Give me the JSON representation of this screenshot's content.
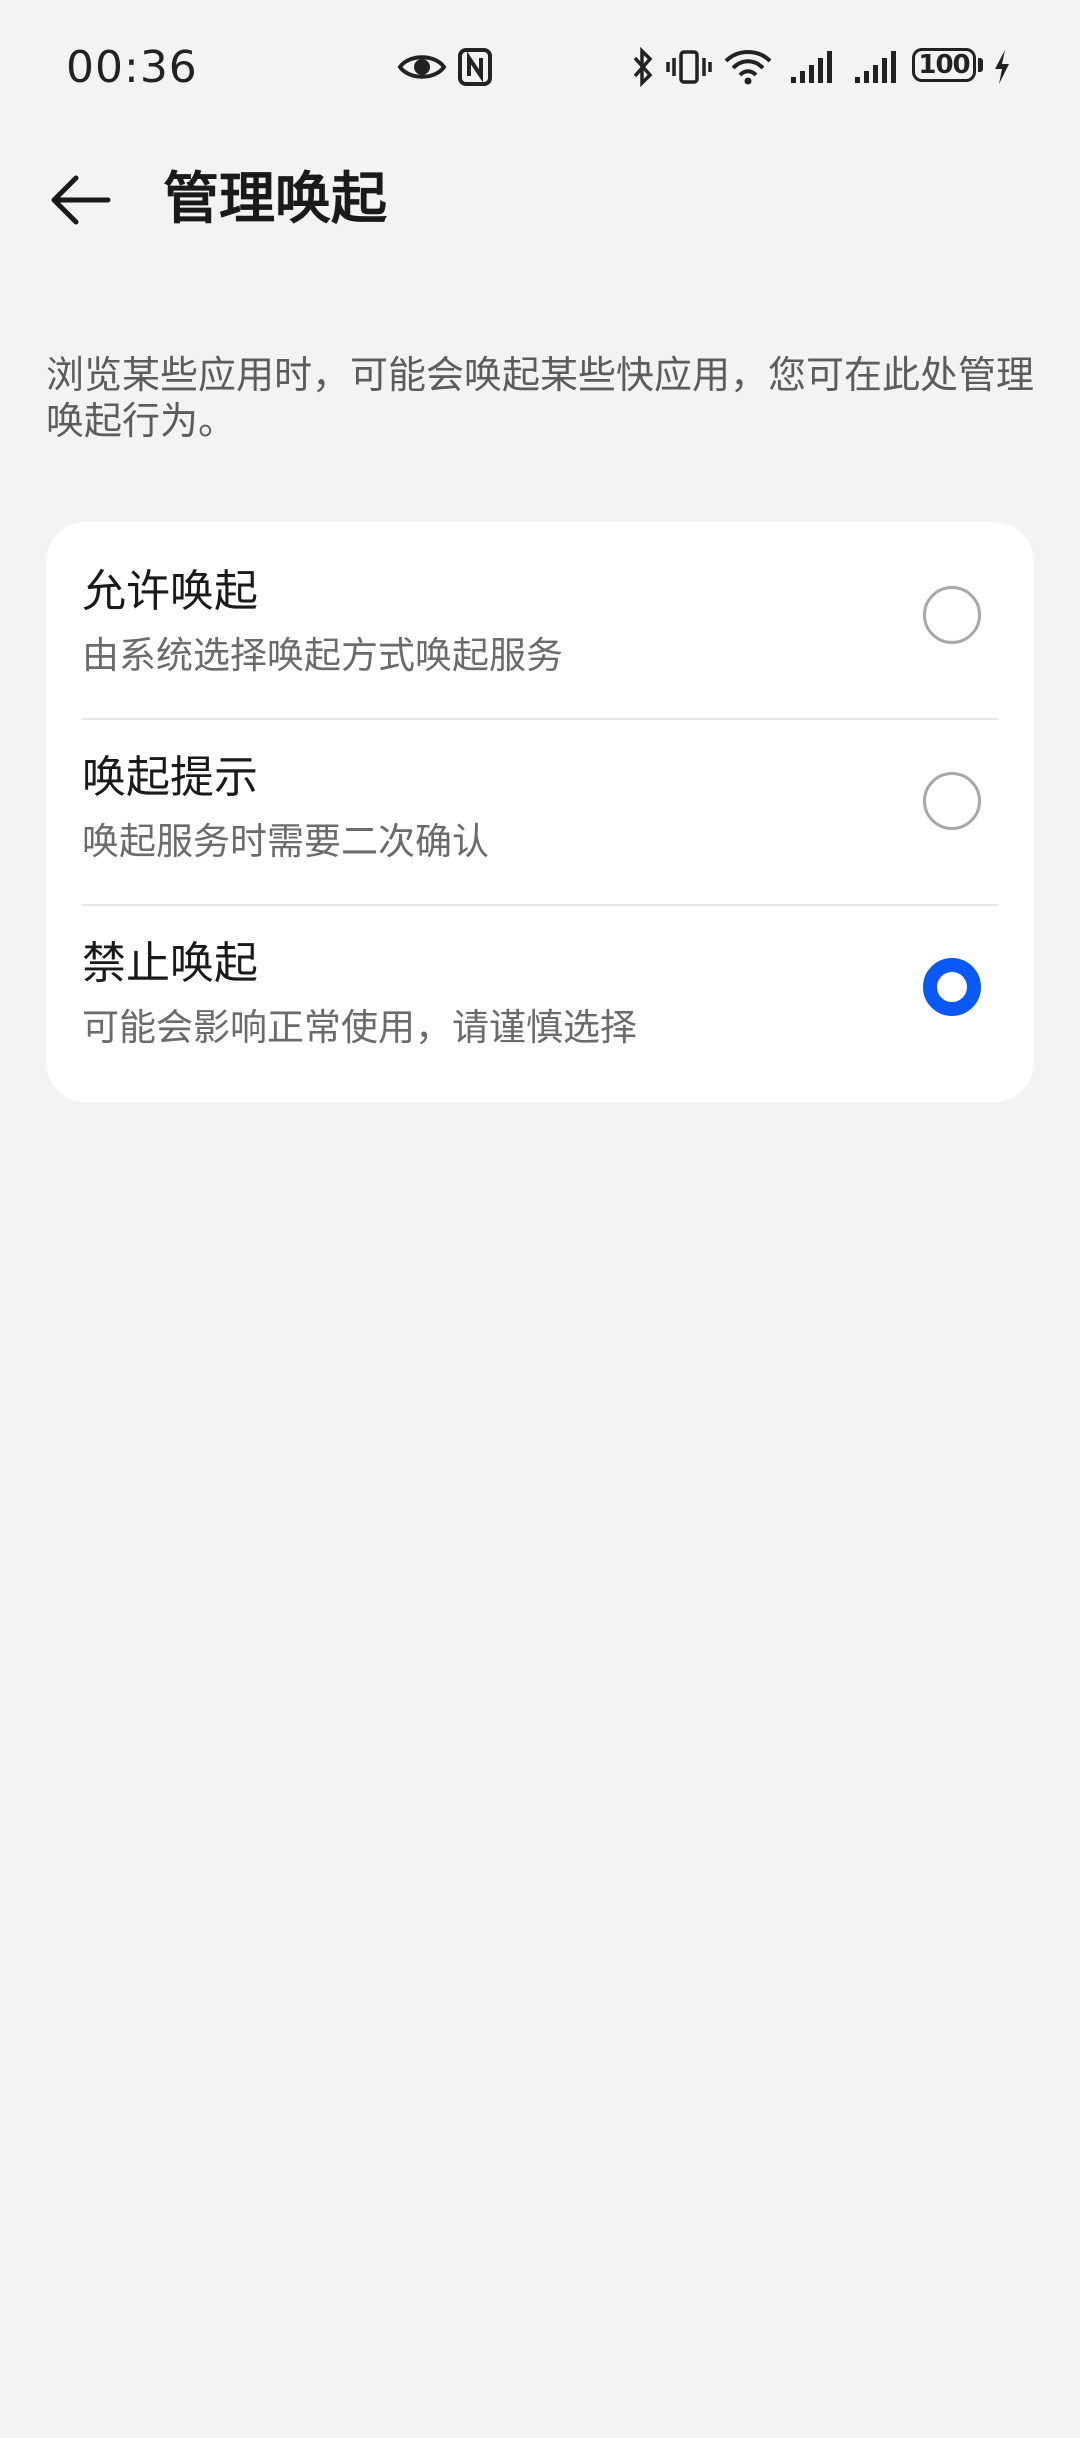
{
  "status_bar": {
    "time": "00:36",
    "battery_level": "100",
    "icons": [
      "eye-icon",
      "nfc-icon",
      "bluetooth-icon",
      "vibrate-icon",
      "wifi-icon",
      "signal-icon",
      "signal-icon",
      "charging-icon"
    ]
  },
  "header": {
    "back_icon": "back-arrow-icon",
    "title": "管理唤起"
  },
  "description": "浏览某些应用时，可能会唤起某些快应用，您可在此处管理唤起行为。",
  "options": [
    {
      "title": "允许唤起",
      "subtitle": "由系统选择唤起方式唤起服务",
      "selected": false
    },
    {
      "title": "唤起提示",
      "subtitle": "唤起服务时需要二次确认",
      "selected": false
    },
    {
      "title": "禁止唤起",
      "subtitle": "可能会影响正常使用，请谨慎选择",
      "selected": true
    }
  ],
  "colors": {
    "background": "#f1f3f5",
    "card": "#ffffff",
    "accent": "#0a59f7",
    "radio_unchecked": "#a8a8a8"
  }
}
